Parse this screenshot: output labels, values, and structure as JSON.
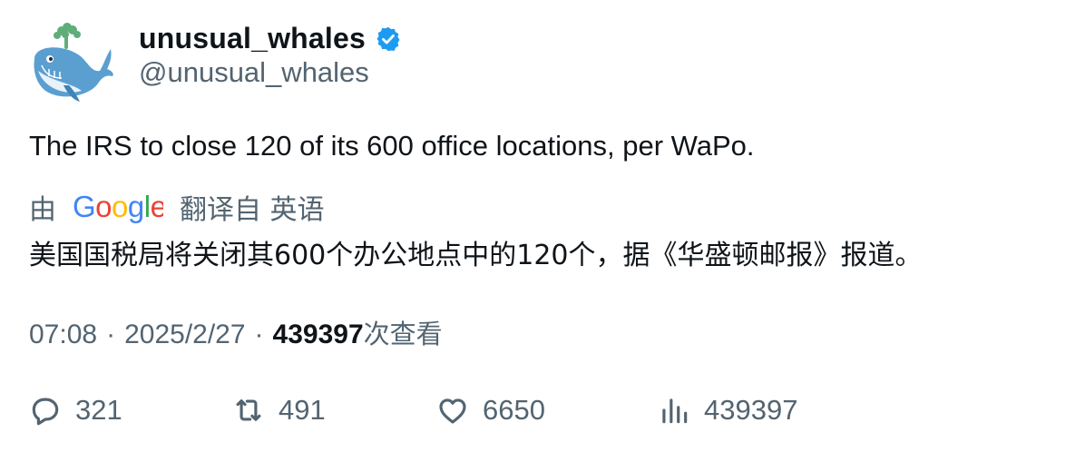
{
  "tweet": {
    "author": {
      "display_name": "unusual_whales",
      "handle": "@unusual_whales",
      "verified": true,
      "avatar_icon": "whale-logo-icon"
    },
    "text": "The IRS to close 120 of its 600 office locations, per WaPo.",
    "translation": {
      "by_label": "由",
      "provider": "Google",
      "label": "翻译自 英语",
      "text": "美国国税局将关闭其600个办公地点中的120个，据《华盛顿邮报》报道。"
    },
    "meta": {
      "time": "07:08",
      "separator": "·",
      "date": "2025/2/27",
      "views_count": "439397",
      "views_label": "次查看"
    },
    "actions": {
      "replies": "321",
      "retweets": "491",
      "likes": "6650",
      "views": "439397"
    }
  },
  "colors": {
    "text_primary": "#0f1419",
    "text_secondary": "#536471",
    "verified_blue": "#1d9bf0",
    "google_blue": "#4285F4",
    "google_red": "#EA4335",
    "google_yellow": "#FBBC05",
    "google_green": "#34A853"
  }
}
